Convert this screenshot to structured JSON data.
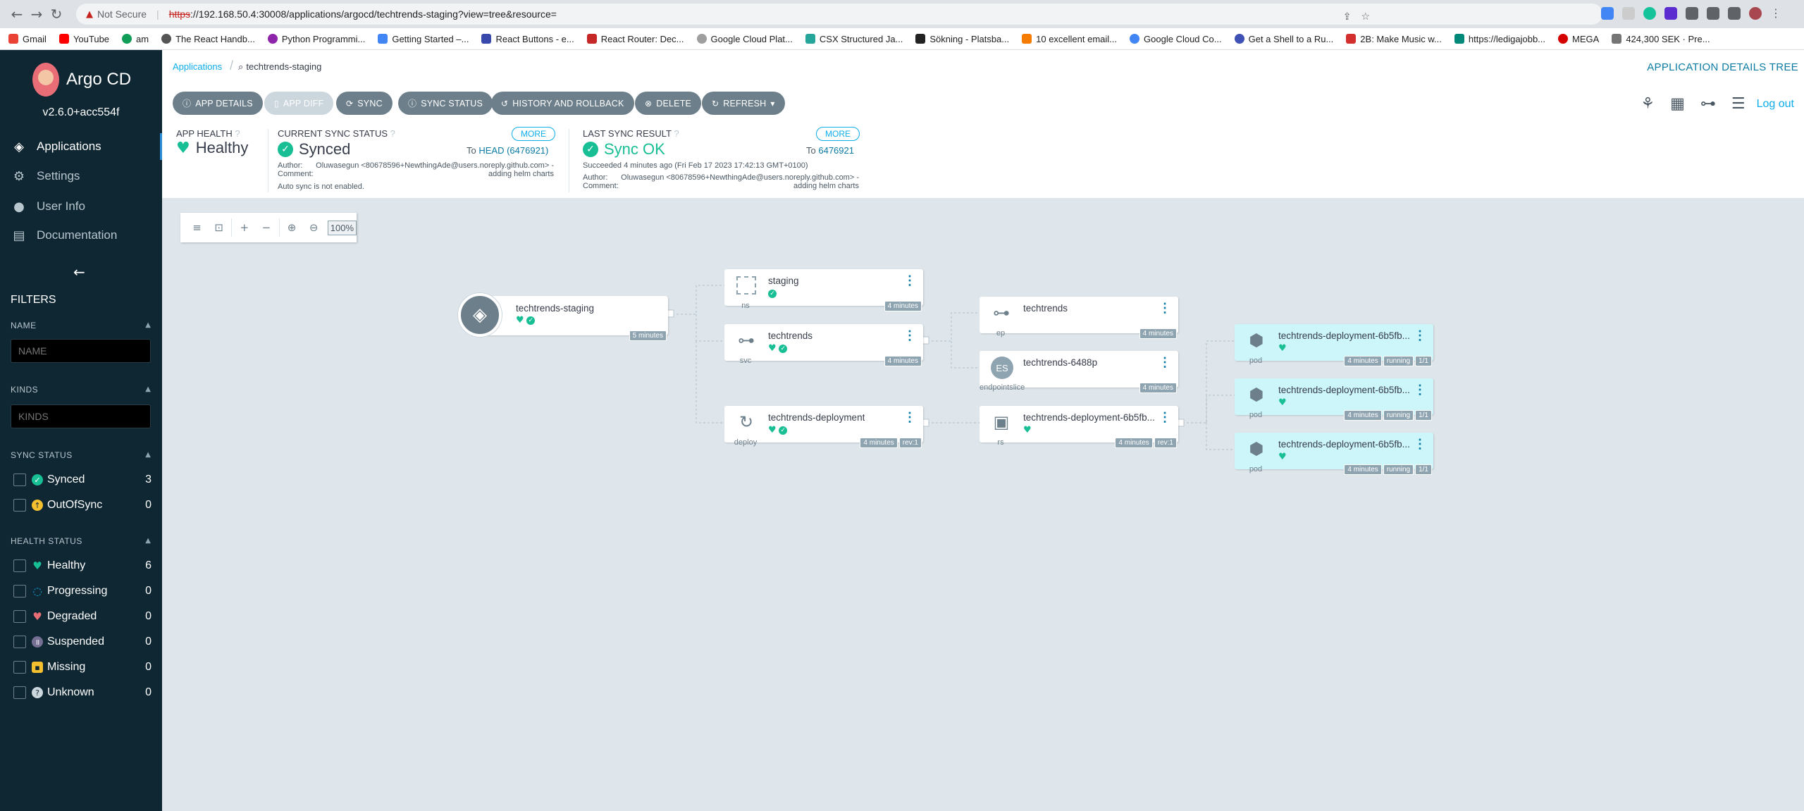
{
  "browser": {
    "not_secure": "Not Secure",
    "url_scheme": "https",
    "url_rest": "://192.168.50.4:30008/applications/argocd/techtrends-staging?view=tree&resource="
  },
  "bookmarks": [
    "Gmail",
    "YouTube",
    "am",
    "The React Handb...",
    "Python Programmi...",
    "Getting Started –...",
    "React Buttons - e...",
    "React Router: Dec...",
    "Google Cloud Plat...",
    "CSX Structured Ja...",
    "Sökning - Platsba...",
    "10 excellent email...",
    "Google Cloud Co...",
    "Get a Shell to a Ru...",
    "2B: Make Music w...",
    "https://ledigajobb...",
    "MEGA",
    "424,300 SEK · Pre..."
  ],
  "sidebar": {
    "logo": "Argo CD",
    "version": "v2.6.0+acc554f",
    "nav": [
      "Applications",
      "Settings",
      "User Info",
      "Documentation"
    ],
    "filters_title": "FILTERS",
    "name_label": "NAME",
    "name_placeholder": "NAME",
    "kinds_label": "KINDS",
    "kinds_placeholder": "KINDS",
    "sync_label": "SYNC STATUS",
    "sync_items": [
      {
        "label": "Synced",
        "count": "3"
      },
      {
        "label": "OutOfSync",
        "count": "0"
      }
    ],
    "health_label": "HEALTH STATUS",
    "health_items": [
      {
        "label": "Healthy",
        "count": "6"
      },
      {
        "label": "Progressing",
        "count": "0"
      },
      {
        "label": "Degraded",
        "count": "0"
      },
      {
        "label": "Suspended",
        "count": "0"
      },
      {
        "label": "Missing",
        "count": "0"
      },
      {
        "label": "Unknown",
        "count": "0"
      }
    ]
  },
  "header": {
    "breadcrumb_root": "Applications",
    "breadcrumb_current": "techtrends-staging",
    "title": "APPLICATION DETAILS TREE"
  },
  "toolbar": {
    "buttons": [
      "APP DETAILS",
      "APP DIFF",
      "SYNC",
      "SYNC STATUS",
      "HISTORY AND ROLLBACK",
      "DELETE",
      "REFRESH"
    ],
    "logout": "Log out"
  },
  "status": {
    "app_health_label": "APP HEALTH",
    "app_health_value": "Healthy",
    "sync_status_label": "CURRENT SYNC STATUS",
    "sync_status_value": "Synced",
    "more": "MORE",
    "to_prefix": "To",
    "sync_to": "HEAD (6476921)",
    "author_label": "Author:",
    "author": "Oluwasegun <80678596+NewthingAde@users.noreply.github.com> -",
    "comment_label": "Comment:",
    "comment": "adding helm charts",
    "auto_sync": "Auto sync is not enabled.",
    "last_sync_label": "LAST SYNC RESULT",
    "last_sync_value": "Sync OK",
    "last_sync_to": "6476921",
    "last_sync_time": "Succeeded 4 minutes ago (Fri Feb 17 2023 17:42:13 GMT+0100)"
  },
  "zoom": {
    "percent": "100%"
  },
  "graph": {
    "app": {
      "name": "techtrends-staging",
      "age": "5 minutes"
    },
    "nodes": [
      {
        "name": "staging",
        "kind": "ns",
        "age": "4 minutes"
      },
      {
        "name": "techtrends",
        "kind": "svc",
        "age": "4 minutes"
      },
      {
        "name": "techtrends-deployment",
        "kind": "deploy",
        "age": "4 minutes",
        "rev": "rev:1"
      },
      {
        "name": "techtrends",
        "kind": "ep",
        "age": "4 minutes"
      },
      {
        "name": "techtrends-6488p",
        "kind": "endpointslice",
        "age": "4 minutes",
        "icon_text": "ES"
      },
      {
        "name": "techtrends-deployment-6b5fb...",
        "kind": "rs",
        "age": "4 minutes",
        "rev": "rev:1"
      },
      {
        "name": "techtrends-deployment-6b5fb...",
        "kind": "pod",
        "age": "4 minutes",
        "state": "running",
        "ready": "1/1"
      },
      {
        "name": "techtrends-deployment-6b5fb...",
        "kind": "pod",
        "age": "4 minutes",
        "state": "running",
        "ready": "1/1"
      },
      {
        "name": "techtrends-deployment-6b5fb...",
        "kind": "pod",
        "age": "4 minutes",
        "state": "running",
        "ready": "1/1"
      }
    ]
  },
  "colors": {
    "healthy": "#18be94",
    "accent": "#0dadea",
    "sidebar": "#0f2733"
  }
}
